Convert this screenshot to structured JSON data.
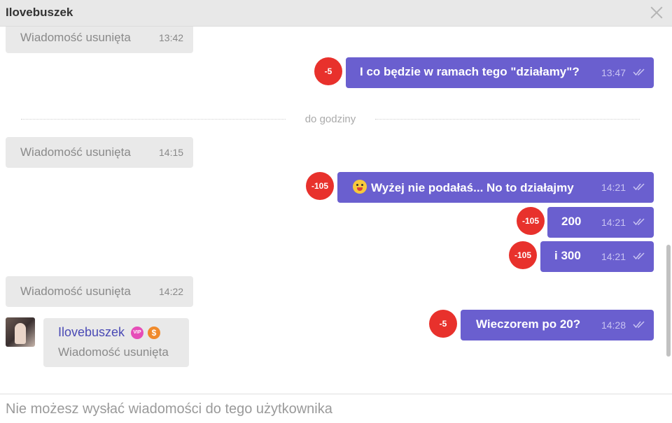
{
  "header": {
    "title": "Ilovebuszek"
  },
  "divider": {
    "label": "do godziny"
  },
  "messages": {
    "d1": {
      "text": "Wiadomość usunięta",
      "time": "13:42"
    },
    "o1": {
      "text": "I co będzie w ramach tego \"działamy\"?",
      "time": "13:47",
      "badge": "-5"
    },
    "d2": {
      "text": "Wiadomość usunięta",
      "time": "14:15"
    },
    "o2": {
      "text": "Wyżej nie podałaś... No to działajmy",
      "time": "14:21",
      "badge": "-105",
      "emoji": "tongue-out-emoji"
    },
    "o3": {
      "text": "200",
      "time": "14:21",
      "badge": "-105"
    },
    "o4": {
      "text": "i 300",
      "time": "14:21",
      "badge": "-105"
    },
    "d3": {
      "text": "Wiadomość usunięta",
      "time": "14:22"
    },
    "o5": {
      "text": "Wieczorem po 20?",
      "time": "14:28",
      "badge": "-5"
    }
  },
  "sender_card": {
    "name": "Ilovebuszek",
    "vip_label": "VIP",
    "coin_label": "$",
    "text": "Wiadomość usunięta"
  },
  "footer": {
    "text": "Nie możesz wysłać wiadomości do tego użytkownika"
  },
  "colors": {
    "outgoing": "#6a5fcf",
    "badge": "#e8312c",
    "deleted_bg": "#e9e9e9"
  }
}
